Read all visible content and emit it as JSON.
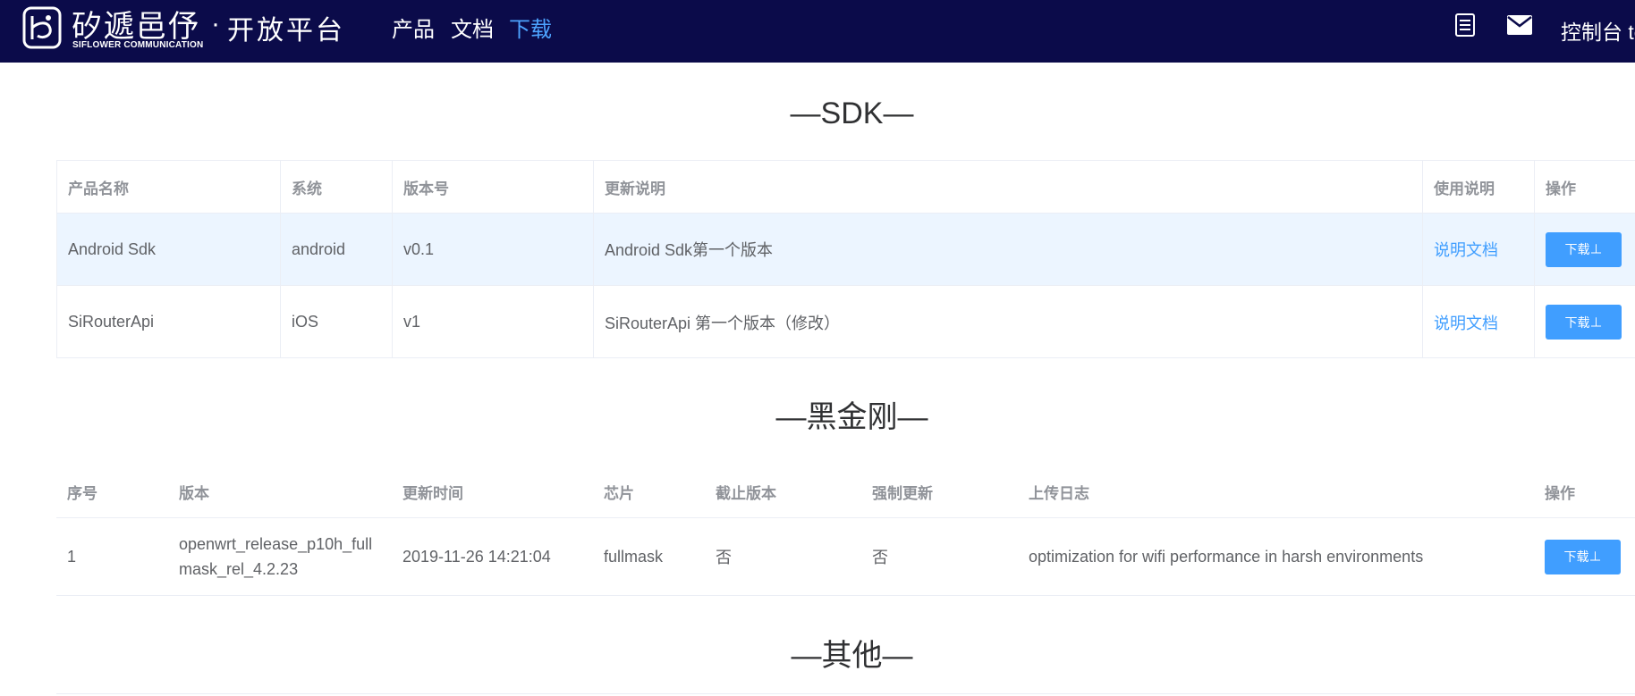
{
  "header": {
    "brand_cn": "矽遞邑伃",
    "brand_en": "SIFLOWER COMMUNICATION",
    "brand_sep": "·",
    "brand_sub": "开放平台",
    "nav": [
      {
        "label": "产品",
        "active": false
      },
      {
        "label": "文档",
        "active": false
      },
      {
        "label": "下载",
        "active": true
      }
    ],
    "console_label": "控制台 te",
    "icons": [
      "document-list-icon",
      "mail-icon"
    ]
  },
  "colors": {
    "header_bg": "#0b0b4a",
    "accent": "#409eff",
    "active_nav": "#4da3ff",
    "highlight_row": "#ecf5ff"
  },
  "sdk": {
    "title": "—SDK—",
    "columns": [
      "产品名称",
      "系统",
      "版本号",
      "更新说明",
      "使用说明",
      "操作"
    ],
    "rows": [
      {
        "name": "Android Sdk",
        "system": "android",
        "version": "v0.1",
        "notes": "Android Sdk第一个版本",
        "doc": "说明文档",
        "action": "下载⊥"
      },
      {
        "name": "SiRouterApi",
        "system": "iOS",
        "version": "v1",
        "notes": "SiRouterApi 第一个版本（修改）",
        "doc": "说明文档",
        "action": "下载⊥"
      }
    ]
  },
  "hjg": {
    "title": "—黑金刚—",
    "columns": [
      "序号",
      "版本",
      "更新时间",
      "芯片",
      "截止版本",
      "强制更新",
      "上传日志",
      "操作"
    ],
    "rows": [
      {
        "index": "1",
        "version": "openwrt_release_p10h_fullmask_rel_4.2.23",
        "time": "2019-11-26 14:21:04",
        "chip": "fullmask",
        "cutoff": "否",
        "force": "否",
        "log": "optimization for wifi performance in harsh environments",
        "action": "下载⊥"
      }
    ]
  },
  "other": {
    "title": "—其他—"
  }
}
